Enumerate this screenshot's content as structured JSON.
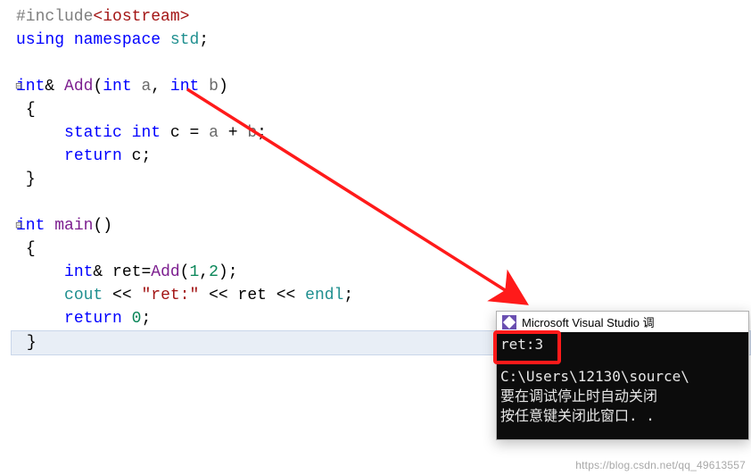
{
  "code": {
    "l1_pp": "#include",
    "l1_inc": "<iostream>",
    "l2_kw_using": "using",
    "l2_kw_ns": "namespace",
    "l2_std": "std",
    "l4_ty_int": "int",
    "l4_amp": "&",
    "l4_fn": "Add",
    "l4_param_ty1": "int",
    "l4_param_a": "a",
    "l4_param_ty2": "int",
    "l4_param_b": "b",
    "l6_kw_static": "static",
    "l6_ty_int": "int",
    "l6_c": "c",
    "l6_a": "a",
    "l6_b": "b",
    "l7_kw_return": "return",
    "l7_c": "c",
    "l10_ty_int": "int",
    "l10_fn": "main",
    "l12_ty_int": "int",
    "l12_amp": "&",
    "l12_ret": "ret",
    "l12_add": "Add",
    "l12_n1": "1",
    "l12_n2": "2",
    "l13_cout": "cout",
    "l13_str": "\"ret:\"",
    "l13_ret": "ret",
    "l13_endl": "endl",
    "l14_kw_return": "return",
    "l14_zero": "0"
  },
  "console": {
    "title": "Microsoft Visual Studio 调",
    "out_line": "ret:3",
    "path_line": "C:\\Users\\12130\\source\\",
    "msg1": "要在调试停止时自动关闭",
    "msg2": "按任意键关闭此窗口. ."
  },
  "watermark": "https://blog.csdn.net/qq_49613557"
}
